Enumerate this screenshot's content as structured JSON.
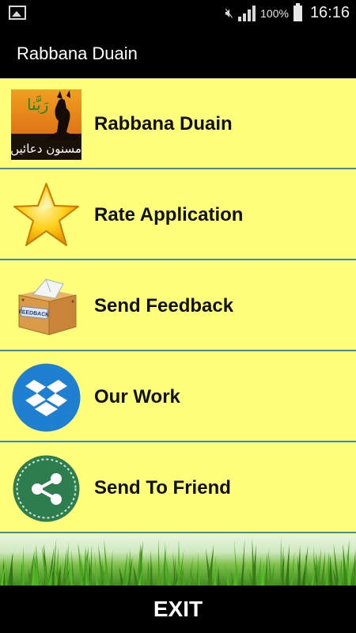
{
  "status_bar": {
    "battery_percent": "100%",
    "time": "16:16"
  },
  "app": {
    "title": "Rabbana Duain"
  },
  "menu": {
    "items": [
      {
        "label": "Rabbana Duain",
        "icon": "dua-book-icon"
      },
      {
        "label": "Rate Application",
        "icon": "star-icon"
      },
      {
        "label": "Send Feedback",
        "icon": "feedback-box-icon"
      },
      {
        "label": "Our Work",
        "icon": "dropbox-icon"
      },
      {
        "label": "Send To Friend",
        "icon": "share-icon"
      }
    ]
  },
  "icon_texts": {
    "urdu_top": "رَبَّنا",
    "urdu_bottom": "مسنون دعائیں",
    "feedback_box": "FEEDBACK"
  },
  "footer": {
    "exit_label": "EXIT"
  },
  "colors": {
    "menu_background": "#ffff7c",
    "divider": "#3d8fa0",
    "bar_background": "#000000"
  }
}
